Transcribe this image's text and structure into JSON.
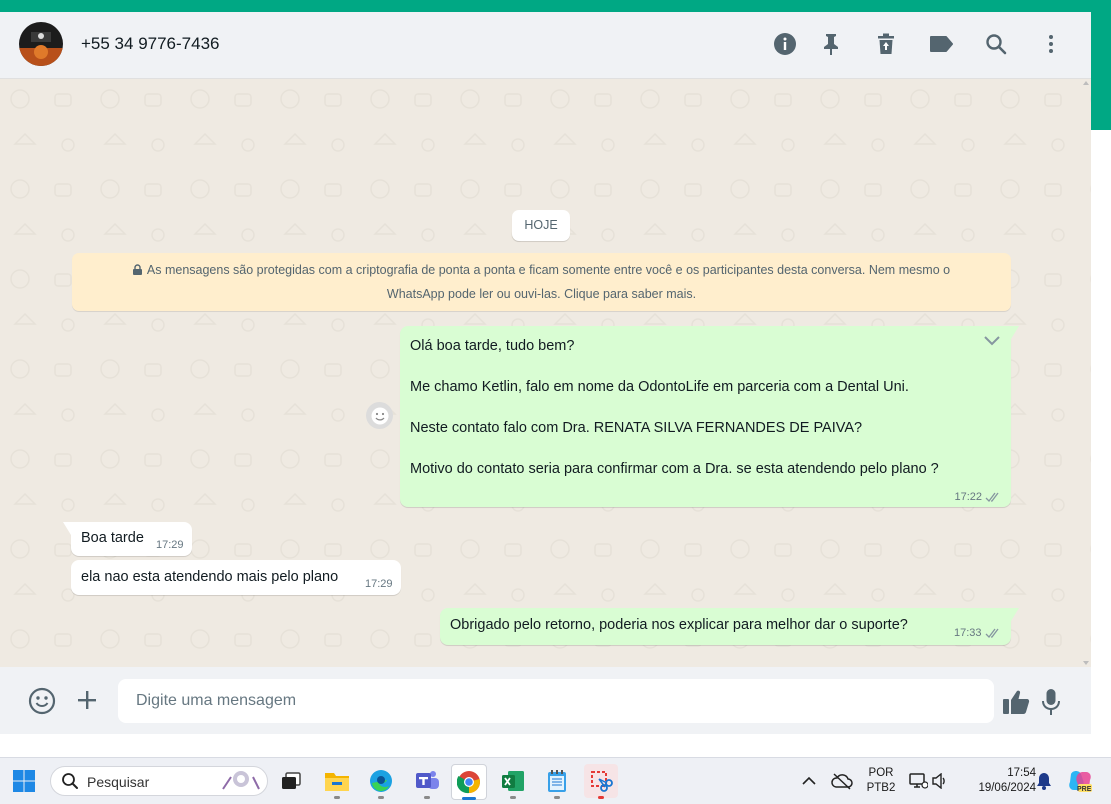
{
  "header": {
    "contact_name": "+55 34 9776-7436",
    "icons": [
      "info-icon",
      "pin-icon",
      "delete-icon",
      "label-icon",
      "search-icon",
      "menu-icon"
    ]
  },
  "chat": {
    "date_label": "HOJE",
    "system_message": {
      "line1": "As mensagens são protegidas com a criptografia de ponta a ponta e ficam somente entre você e os participantes desta conversa. Nem mesmo o",
      "line2": "WhatsApp pode ler ou ouvi-las. Clique para saber mais."
    },
    "messages": [
      {
        "direction": "out",
        "lines": [
          "Olá boa tarde, tudo bem?",
          "Me chamo Ketlin, falo em nome da OdontoLife em parceria com a Dental Uni.",
          "Neste contato falo com Dra. RENATA SILVA FERNANDES DE PAIVA?",
          "Motivo do contato seria para confirmar com a Dra. se esta atendendo pelo plano ?"
        ],
        "time": "17:22",
        "status": "read"
      },
      {
        "direction": "in",
        "text": "Boa tarde",
        "time": "17:29"
      },
      {
        "direction": "in",
        "text": "ela nao esta atendendo mais pelo plano",
        "time": "17:29"
      },
      {
        "direction": "out",
        "text": "Obrigado pelo retorno, poderia nos explicar para melhor dar o suporte?",
        "time": "17:33",
        "status": "read"
      }
    ],
    "colors": {
      "outgoing": "#d9fdd3",
      "incoming": "#ffffff",
      "accent": "#00a884",
      "system": "#ffeecd"
    }
  },
  "composer": {
    "placeholder": "Digite uma mensagem",
    "icons": [
      "emoji-icon",
      "plus-icon",
      "thumbs-up-icon",
      "microphone-icon"
    ]
  },
  "taskbar": {
    "search_label": "Pesquisar",
    "apps": [
      "start-icon",
      "task-view-icon",
      "file-explorer-icon",
      "edge-icon",
      "teams-icon",
      "chrome-icon",
      "excel-icon",
      "notepad-icon",
      "snipping-tool-icon"
    ],
    "language_top": "POR",
    "language_bottom": "PTB2",
    "time": "17:54",
    "date": "19/06/2024",
    "copilot_badge": "PRE"
  }
}
